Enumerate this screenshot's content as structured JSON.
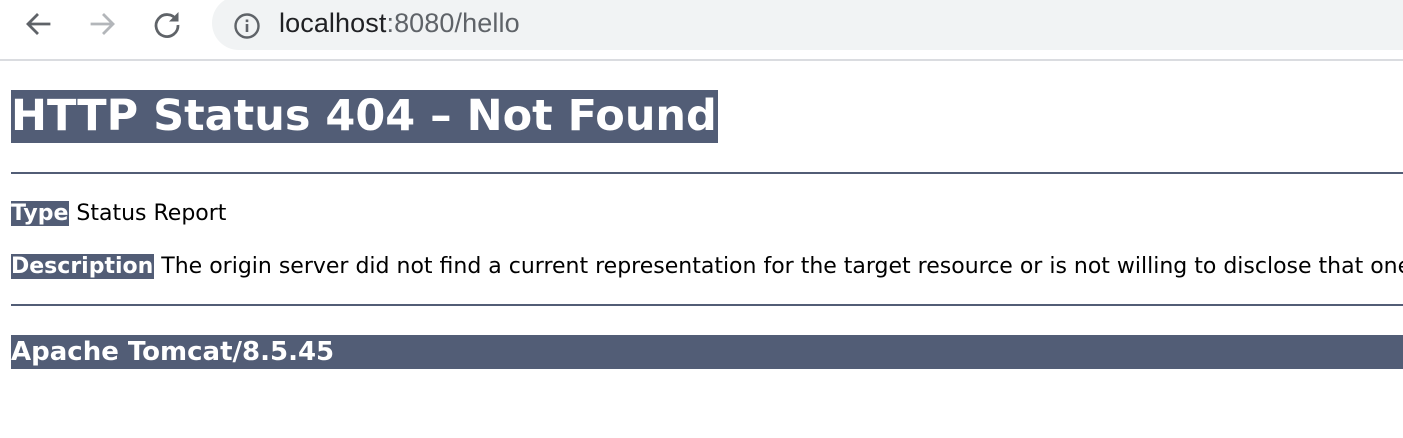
{
  "browser": {
    "back_icon": "arrow-left-icon",
    "forward_icon": "arrow-right-icon",
    "reload_icon": "reload-icon",
    "site_info_icon": "info-circle-icon",
    "url_host": "localhost",
    "url_rest": ":8080/hello"
  },
  "page": {
    "title": "HTTP Status 404 – Not Found",
    "type_label": "Type",
    "type_value": " Status Report",
    "description_label": "Description",
    "description_value": " The origin server did not find a current representation for the target resource or is not willing to disclose that one exis",
    "server_info": "Apache Tomcat/8.5.45",
    "accent_color": "#525d76"
  }
}
